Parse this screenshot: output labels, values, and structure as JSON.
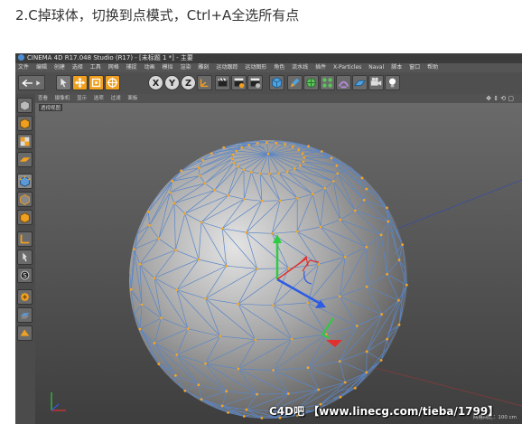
{
  "caption": "2.C掉球体，切换到点模式，Ctrl+A全选所有点",
  "window": {
    "title": "CINEMA 4D R17.048 Studio (R17) - [未标题 1 *] - 主要"
  },
  "menu": [
    "文件",
    "编辑",
    "创建",
    "选择",
    "工具",
    "网格",
    "捕捉",
    "动画",
    "模拟",
    "渲染",
    "雕刻",
    "运动跟踪",
    "运动图形",
    "角色",
    "流水线",
    "插件",
    "X-Particles",
    "Naval",
    "脚本",
    "窗口",
    "帮助"
  ],
  "viewport_menu": [
    "查看",
    "摄像机",
    "显示",
    "选项",
    "过滤",
    "面板"
  ],
  "viewport_label": "透视视图",
  "grid_label": "网格间距：100 cm",
  "watermark": "C4D吧 【www.linecg.com/tieba/1799】",
  "toolbar_icons": [
    "undo-icon",
    "move-icon",
    "scale-icon",
    "rotate-icon",
    "x-axis-icon",
    "y-axis-icon",
    "z-axis-icon",
    "coordinate-system-icon",
    "render-view-icon",
    "render-picture-icon",
    "render-settings-icon",
    "cube-icon",
    "pen-icon",
    "subdivision-icon",
    "array-icon",
    "deformer-icon",
    "floor-icon",
    "camera-icon",
    "light-icon"
  ],
  "colors": {
    "accent": "#f0a020",
    "mesh": "#5a86c8",
    "points": "#f5a623"
  }
}
